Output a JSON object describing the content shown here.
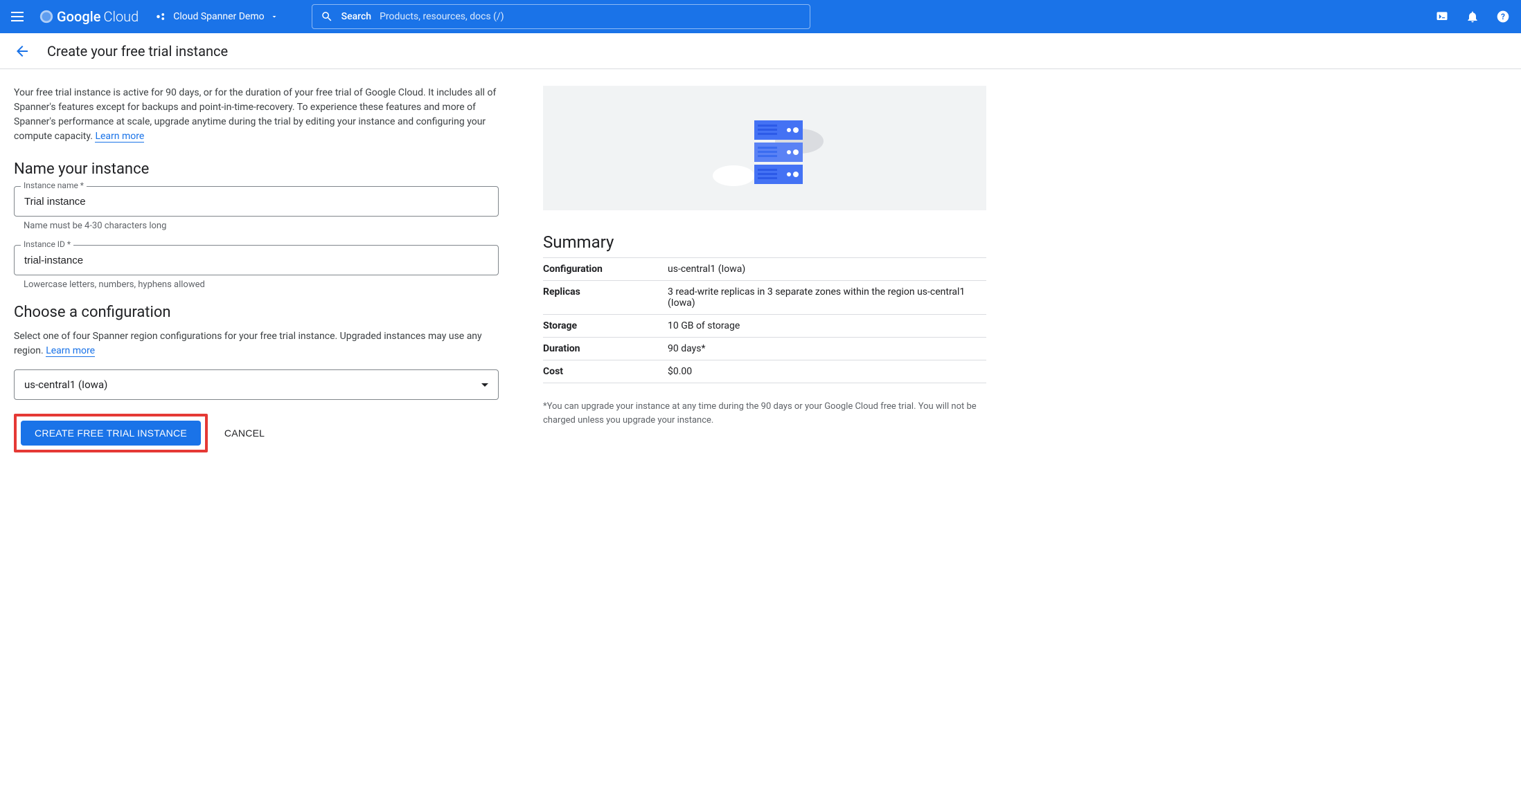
{
  "header": {
    "logo_google": "Google",
    "logo_cloud": "Cloud",
    "project_name": "Cloud Spanner Demo",
    "search_label": "Search",
    "search_placeholder": "Products, resources, docs (/)"
  },
  "page": {
    "title": "Create your free trial instance",
    "intro": "Your free trial instance is active for 90 days, or for the duration of your free trial of Google Cloud. It includes all of Spanner's features except for backups and point-in-time-recovery. To experience these features and more of Spanner's performance at scale, upgrade anytime during the trial by editing your instance and configuring your compute capacity. ",
    "learn_more": "Learn more"
  },
  "form": {
    "name_heading": "Name your instance",
    "instance_name_label": "Instance name *",
    "instance_name_value": "Trial instance",
    "instance_name_helper": "Name must be 4-30 characters long",
    "instance_id_label": "Instance ID *",
    "instance_id_value": "trial-instance",
    "instance_id_helper": "Lowercase letters, numbers, hyphens allowed",
    "config_heading": "Choose a configuration",
    "config_desc": "Select one of four Spanner region configurations for your free trial instance. Upgraded instances may use any region. ",
    "config_value": "us-central1 (Iowa)",
    "create_button": "CREATE FREE TRIAL INSTANCE",
    "cancel_button": "CANCEL"
  },
  "summary": {
    "heading": "Summary",
    "rows": [
      {
        "label": "Configuration",
        "value": "us-central1 (Iowa)"
      },
      {
        "label": "Replicas",
        "value": "3 read-write replicas in 3 separate zones within the region us-central1 (Iowa)"
      },
      {
        "label": "Storage",
        "value": "10 GB of storage"
      },
      {
        "label": "Duration",
        "value": "90 days*"
      },
      {
        "label": "Cost",
        "value": "$0.00"
      }
    ],
    "footnote": "*You can upgrade your instance at any time during the 90 days or your Google Cloud free trial. You will not be charged unless you upgrade your instance."
  }
}
